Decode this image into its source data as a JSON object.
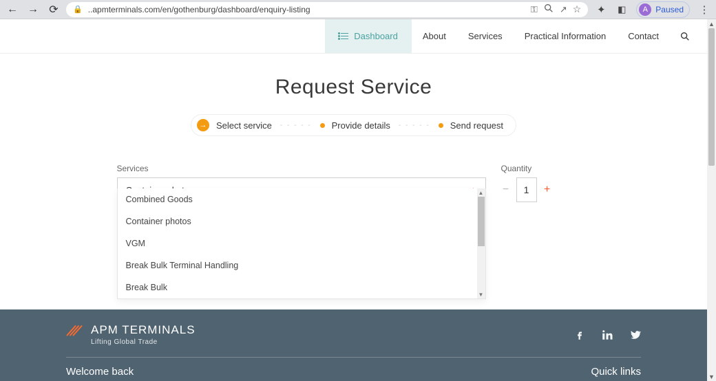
{
  "browser": {
    "url": "..apmterminals.com/en/gothenburg/dashboard/enquiry-listing",
    "profile_initial": "A",
    "profile_status": "Paused"
  },
  "nav": {
    "dashboard": "Dashboard",
    "about": "About",
    "services": "Services",
    "practical": "Practical Information",
    "contact": "Contact"
  },
  "page": {
    "title": "Request Service"
  },
  "steps": {
    "s1": "Select service",
    "s2": "Provide details",
    "s3": "Send request"
  },
  "form": {
    "services_label": "Services",
    "services_selected": "Container photos",
    "quantity_label": "Quantity",
    "quantity_value": "1",
    "options": {
      "o1": "Combined Goods",
      "o2": "Container photos",
      "o3": "VGM",
      "o4": "Break Bulk Terminal Handling",
      "o5": "Break Bulk"
    }
  },
  "footer": {
    "brand": "APM TERMINALS",
    "tagline": "Lifting Global Trade",
    "welcome": "Welcome back",
    "quick": "Quick links"
  }
}
